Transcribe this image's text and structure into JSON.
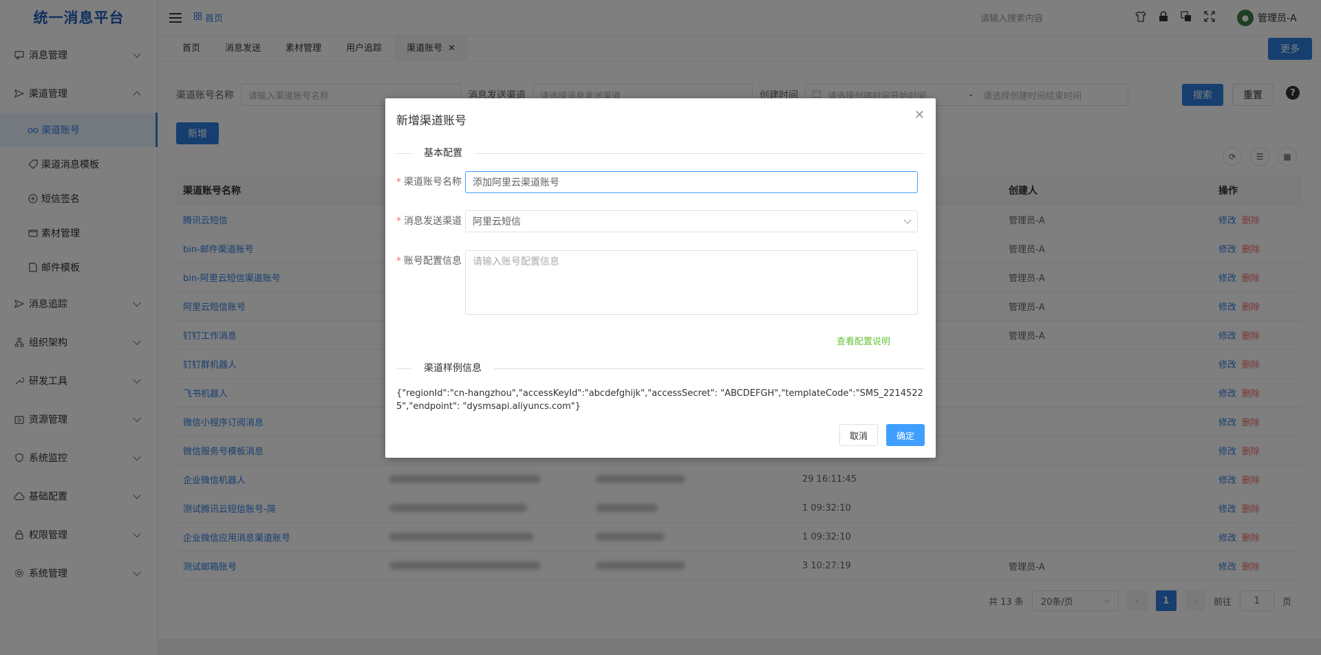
{
  "app": {
    "logo": "统一消息平台"
  },
  "sidebar": {
    "menu1": "消息管理",
    "menu2": "渠道管理",
    "sub": [
      "渠道账号",
      "渠道消息模板",
      "短信签名",
      "素材管理",
      "邮件模板"
    ],
    "menus": [
      "消息追踪",
      "组织架构",
      "研发工具",
      "资源管理",
      "系统监控",
      "基础配置",
      "权限管理",
      "系统管理"
    ]
  },
  "header": {
    "breadcrumb": "首页",
    "search_placeholder": "请输入搜索内容",
    "user": "管理员-A"
  },
  "tabs": [
    "首页",
    "消息发送",
    "素材管理",
    "用户追踪",
    "渠道账号"
  ],
  "more_label": "更多",
  "filters": {
    "name_label": "渠道账号名称",
    "name_placeholder": "请输入渠道账号名称",
    "channel_label": "消息发送渠道",
    "channel_placeholder": "请选择消息发送渠道",
    "time_label": "创建时间",
    "start_placeholder": "请选择创建时间开始时间",
    "dash": "-",
    "end_placeholder": "请选择创建时间结束时间",
    "search": "搜索",
    "reset": "重置"
  },
  "add_label": "新增",
  "table": {
    "headers": [
      "渠道账号名称",
      "",
      "",
      "",
      "创建人",
      "操作"
    ],
    "edit": "修改",
    "delete": "删除",
    "rows": [
      {
        "name": "腾讯云短信",
        "time": "",
        "creator": "管理员-A"
      },
      {
        "name": "bin-邮件渠道账号",
        "time": "",
        "creator": "管理员-A"
      },
      {
        "name": "bin-阿里云短信渠道账号",
        "time": "",
        "creator": "管理员-A"
      },
      {
        "name": "阿里云短信账号",
        "time": "",
        "creator": "管理员-A"
      },
      {
        "name": "钉钉工作消息",
        "time": "",
        "creator": "管理员-A"
      },
      {
        "name": "钉钉群机器人",
        "time": "",
        "creator": ""
      },
      {
        "name": "飞书机器人",
        "time": "",
        "creator": ""
      },
      {
        "name": "微信小程序订阅消息",
        "time": "",
        "creator": ""
      },
      {
        "name": "微信服务号模板消息",
        "time": "",
        "creator": ""
      },
      {
        "name": "企业微信机器人",
        "time": "29 16:11:45",
        "creator": ""
      },
      {
        "name": "测试腾讯云短信账号-简",
        "time": "1 09:32:10",
        "creator": ""
      },
      {
        "name": "企业微信应用消息渠道账号",
        "time": "1 09:32:10",
        "creator": ""
      },
      {
        "name": "测试邮箱账号",
        "time": "3 10:27:19",
        "creator": "管理员-A"
      }
    ]
  },
  "pager": {
    "total": "共 13 条",
    "size": "20条/页",
    "page": "1",
    "goto": "前往",
    "goto_value": "1",
    "unit": "页"
  },
  "dialog": {
    "title": "新增渠道账号",
    "section1": "基本配置",
    "f1_label": "渠道账号名称",
    "f1_value": "添加阿里云渠道账号",
    "f2_label": "消息发送渠道",
    "f2_value": "阿里云短信",
    "f3_label": "账号配置信息",
    "f3_placeholder": "请输入账号配置信息",
    "config_link": "查看配置说明",
    "section2": "渠道样例信息",
    "sample": "{\"regionId\":\"cn-hangzhou\",\"accessKeyId\":\"abcdefghijk\",\"accessSecret\": \"ABCDEFGH\",\"templateCode\":\"SMS_22145225\",\"endpoint\": \"dysmsapi.aliyuncs.com\"}",
    "cancel": "取消",
    "confirm": "确定"
  }
}
